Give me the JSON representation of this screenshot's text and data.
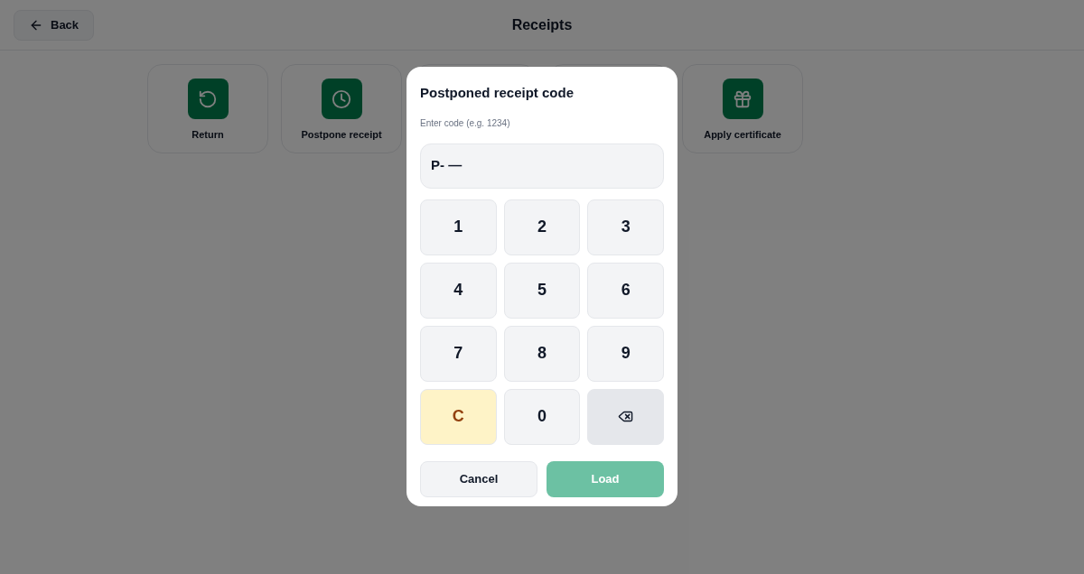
{
  "header": {
    "back_label": "Back",
    "title": "Receipts"
  },
  "actions": [
    {
      "label": "Return",
      "kind": "rotate"
    },
    {
      "label": "Postpone receipt",
      "kind": "clock"
    },
    {
      "kind": "hidden"
    },
    {
      "kind": "hidden"
    },
    {
      "label": "Apply certificate",
      "kind": "gift"
    }
  ],
  "dialog": {
    "title": "Postponed receipt code",
    "hint": "Enter code (e.g. 1234)",
    "value": "P- —",
    "keys": [
      {
        "kind": "digit",
        "label": "1"
      },
      {
        "kind": "digit",
        "label": "2"
      },
      {
        "kind": "digit",
        "label": "3"
      },
      {
        "kind": "digit",
        "label": "4"
      },
      {
        "kind": "digit",
        "label": "5"
      },
      {
        "kind": "digit",
        "label": "6"
      },
      {
        "kind": "digit",
        "label": "7"
      },
      {
        "kind": "digit",
        "label": "8"
      },
      {
        "kind": "digit",
        "label": "9"
      },
      {
        "kind": "clear",
        "label": "C"
      },
      {
        "kind": "digit",
        "label": "0"
      },
      {
        "kind": "backspace"
      }
    ],
    "cancel_label": "Cancel",
    "load": {
      "label": "Load",
      "disabled": true
    }
  }
}
